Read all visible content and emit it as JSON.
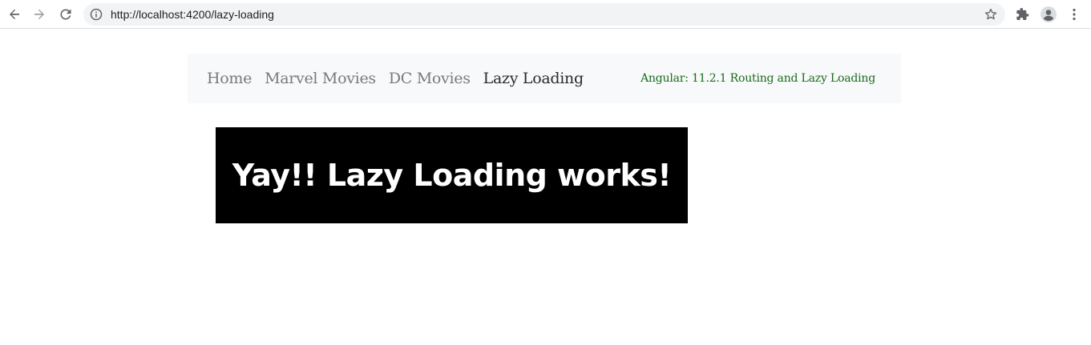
{
  "browser": {
    "url": "http://localhost:4200/lazy-loading",
    "icons": {
      "back": "arrow-left-icon",
      "forward": "arrow-right-icon",
      "reload": "reload-icon",
      "info": "info-icon",
      "bookmark": "star-icon",
      "extensions": "puzzle-icon",
      "profile": "avatar-icon",
      "menu": "kebab-menu-icon"
    }
  },
  "navbar": {
    "links": [
      {
        "label": "Home",
        "active": false
      },
      {
        "label": "Marvel Movies",
        "active": false
      },
      {
        "label": "DC Movies",
        "active": false
      },
      {
        "label": "Lazy Loading",
        "active": true
      }
    ],
    "brand": "Angular: 11.2.1 Routing and Lazy Loading"
  },
  "content": {
    "banner_text": "Yay!! Lazy Loading works!"
  },
  "colors": {
    "navbar_bg": "#f8f9fa",
    "link_inactive": "#7a7a7a",
    "link_active": "#2b2b2b",
    "brand": "#1b6b1b",
    "banner_bg": "#000000",
    "banner_text": "#ffffff"
  }
}
